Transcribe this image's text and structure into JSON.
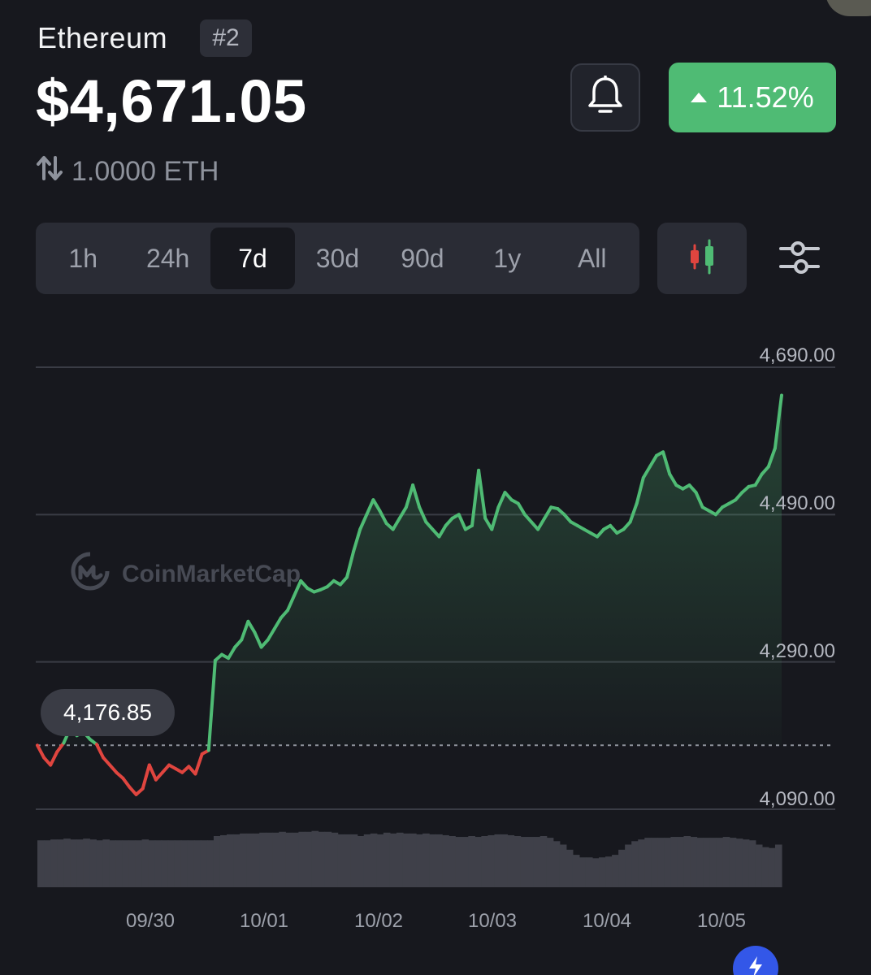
{
  "asset": {
    "name": "Ethereum",
    "rank": "#2",
    "price": "$4,671.05",
    "change_percent": "11.52%",
    "change_direction": "up",
    "conversion": "1.0000 ETH"
  },
  "timeframes": [
    {
      "label": "1h",
      "active": false
    },
    {
      "label": "24h",
      "active": false
    },
    {
      "label": "7d",
      "active": true
    },
    {
      "label": "30d",
      "active": false
    },
    {
      "label": "90d",
      "active": false
    },
    {
      "label": "1y",
      "active": false
    },
    {
      "label": "All",
      "active": false
    }
  ],
  "icons": {
    "alert": "bell-icon",
    "chart_type": "candlestick-icon",
    "settings": "sliders-icon",
    "convert": "swap-arrows-icon",
    "fab": "lightning-icon"
  },
  "colors": {
    "up": "#4fbb74",
    "down": "#e0453f",
    "background": "#17181e"
  },
  "chart": {
    "watermark": "CoinMarketCap",
    "start_price_label": "4,176.85",
    "gridlines": [
      "4,690.00",
      "4,490.00",
      "4,290.00",
      "4,090.00"
    ],
    "dates": [
      "09/30",
      "10/01",
      "10/02",
      "10/03",
      "10/04",
      "10/05"
    ]
  },
  "chart_data": {
    "type": "area",
    "title": "",
    "xlabel": "",
    "ylabel": "",
    "ylim": [
      4090,
      4690
    ],
    "baseline": 4176.85,
    "x_ticks": [
      "09/30",
      "10/01",
      "10/02",
      "10/03",
      "10/04",
      "10/05"
    ],
    "series": [
      {
        "values": [
          4176.85,
          4160,
          4150,
          4168,
          4180,
          4200,
          4190,
          4195,
          4185,
          4178,
          4160,
          4150,
          4140,
          4132,
          4120,
          4110,
          4118,
          4150,
          4130,
          4140,
          4150,
          4145,
          4140,
          4148,
          4138,
          4165,
          4170,
          4292,
          4300,
          4295,
          4310,
          4320,
          4345,
          4330,
          4310,
          4320,
          4335,
          4350,
          4360,
          4380,
          4400,
          4390,
          4385,
          4388,
          4392,
          4400,
          4395,
          4405,
          4440,
          4470,
          4490,
          4510,
          4495,
          4478,
          4470,
          4485,
          4500,
          4530,
          4500,
          4480,
          4470,
          4460,
          4475,
          4485,
          4490,
          4470,
          4475,
          4550,
          4485,
          4470,
          4500,
          4520,
          4510,
          4505,
          4490,
          4480,
          4470,
          4485,
          4500,
          4498,
          4490,
          4480,
          4475,
          4470,
          4465,
          4460,
          4470,
          4475,
          4465,
          4470,
          4480,
          4505,
          4540,
          4555,
          4570,
          4575,
          4545,
          4530,
          4525,
          4530,
          4520,
          4500,
          4495,
          4490,
          4500,
          4505,
          4510,
          4520,
          4528,
          4530,
          4545,
          4555,
          4580,
          4652
        ]
      }
    ]
  },
  "volume_data": {
    "values": [
      0.55,
      0.55,
      0.56,
      0.56,
      0.57,
      0.56,
      0.56,
      0.57,
      0.56,
      0.55,
      0.56,
      0.55,
      0.55,
      0.55,
      0.55,
      0.55,
      0.56,
      0.55,
      0.55,
      0.55,
      0.55,
      0.55,
      0.55,
      0.55,
      0.55,
      0.55,
      0.55,
      0.6,
      0.61,
      0.62,
      0.62,
      0.63,
      0.63,
      0.63,
      0.64,
      0.64,
      0.64,
      0.65,
      0.64,
      0.64,
      0.65,
      0.65,
      0.66,
      0.65,
      0.65,
      0.64,
      0.62,
      0.62,
      0.62,
      0.6,
      0.62,
      0.63,
      0.62,
      0.64,
      0.63,
      0.64,
      0.63,
      0.63,
      0.62,
      0.63,
      0.62,
      0.62,
      0.61,
      0.6,
      0.59,
      0.59,
      0.6,
      0.59,
      0.6,
      0.61,
      0.62,
      0.62,
      0.61,
      0.6,
      0.59,
      0.59,
      0.59,
      0.6,
      0.58,
      0.54,
      0.5,
      0.44,
      0.38,
      0.35,
      0.35,
      0.34,
      0.35,
      0.36,
      0.38,
      0.44,
      0.5,
      0.54,
      0.56,
      0.58,
      0.58,
      0.58,
      0.58,
      0.59,
      0.59,
      0.6,
      0.59,
      0.58,
      0.58,
      0.58,
      0.58,
      0.59,
      0.58,
      0.57,
      0.56,
      0.55,
      0.5,
      0.47,
      0.46,
      0.5
    ]
  }
}
